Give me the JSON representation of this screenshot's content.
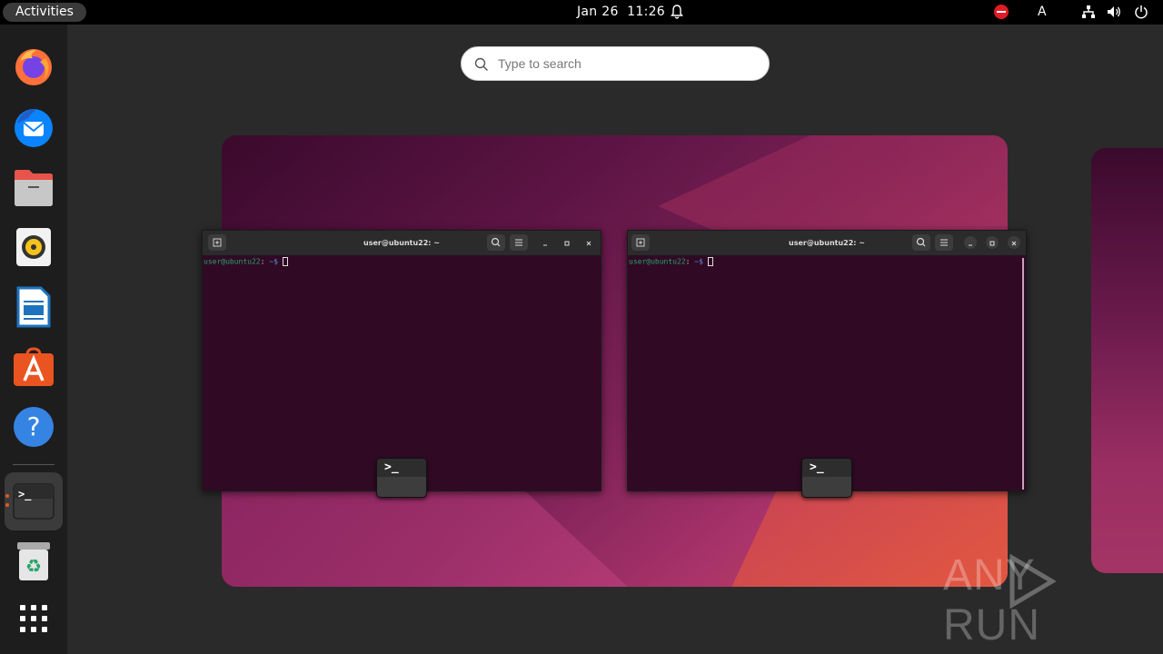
{
  "topbar": {
    "activities_label": "Activities",
    "date": "Jan 26",
    "time": "11:26",
    "keyboard_layout": "A",
    "tray_icons": [
      "notification-bell-icon",
      "do-not-disturb-icon",
      "network-icon",
      "volume-icon",
      "power-icon"
    ]
  },
  "dock": {
    "apps": [
      {
        "name": "Firefox",
        "icon": "firefox-icon"
      },
      {
        "name": "Thunderbird",
        "icon": "thunderbird-icon"
      },
      {
        "name": "Files",
        "icon": "files-icon"
      },
      {
        "name": "Rhythmbox",
        "icon": "rhythmbox-icon"
      },
      {
        "name": "LibreOffice Writer",
        "icon": "writer-icon"
      },
      {
        "name": "Ubuntu Software",
        "icon": "software-icon"
      },
      {
        "name": "Help",
        "icon": "help-icon"
      },
      {
        "name": "Terminal",
        "icon": "terminal-icon",
        "running": true
      },
      {
        "name": "Trash",
        "icon": "trash-icon"
      },
      {
        "name": "Show Applications",
        "icon": "app-grid-icon"
      }
    ]
  },
  "search": {
    "placeholder": "Type to search"
  },
  "windows": [
    {
      "title": "user@ubuntu22: ~",
      "prompt_user": "user@ubuntu22",
      "prompt_path": ":",
      "prompt_suffix": " ~$ "
    },
    {
      "title": "user@ubuntu22: ~",
      "prompt_user": "user@ubuntu22",
      "prompt_path": ":",
      "prompt_suffix": " ~$ "
    }
  ],
  "watermark": {
    "left": "ANY",
    "right": "RUN"
  },
  "colors": {
    "terminal_bg": "#300a24",
    "accent": "#e95420",
    "prompt_user": "#26a269"
  }
}
